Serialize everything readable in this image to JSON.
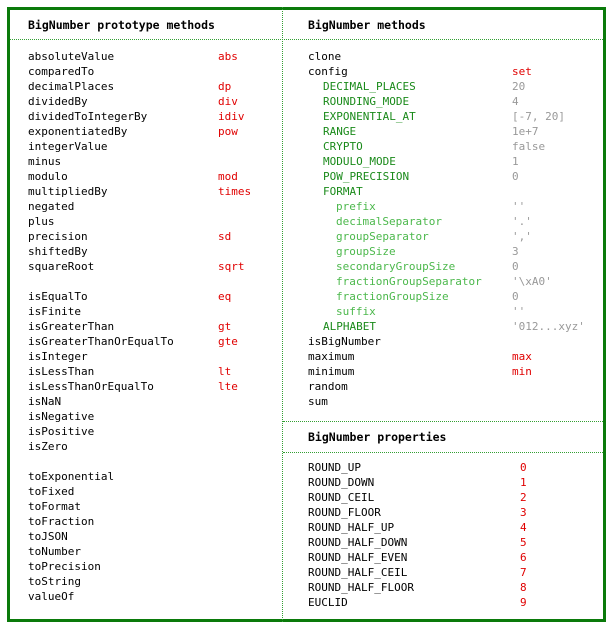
{
  "colors": {
    "border": "#0a7a0a",
    "divider": "#33a033",
    "alias": "#e00000",
    "config_option": "#1a8a1a",
    "format_option": "#4cb84c",
    "default_value": "#999999"
  },
  "prototype_methods": {
    "title": "BigNumber prototype methods",
    "groups": [
      [
        {
          "name": "absoluteValue",
          "alias": "abs"
        },
        {
          "name": "comparedTo",
          "alias": ""
        },
        {
          "name": "decimalPlaces",
          "alias": "dp"
        },
        {
          "name": "dividedBy",
          "alias": "div"
        },
        {
          "name": "dividedToIntegerBy",
          "alias": "idiv"
        },
        {
          "name": "exponentiatedBy",
          "alias": "pow"
        },
        {
          "name": "integerValue",
          "alias": ""
        },
        {
          "name": "minus",
          "alias": ""
        },
        {
          "name": "modulo",
          "alias": "mod"
        },
        {
          "name": "multipliedBy",
          "alias": "times"
        },
        {
          "name": "negated",
          "alias": ""
        },
        {
          "name": "plus",
          "alias": ""
        },
        {
          "name": "precision",
          "alias": "sd"
        },
        {
          "name": "shiftedBy",
          "alias": ""
        },
        {
          "name": "squareRoot",
          "alias": "sqrt"
        }
      ],
      [
        {
          "name": "isEqualTo",
          "alias": "eq"
        },
        {
          "name": "isFinite",
          "alias": ""
        },
        {
          "name": "isGreaterThan",
          "alias": "gt"
        },
        {
          "name": "isGreaterThanOrEqualTo",
          "alias": "gte"
        },
        {
          "name": "isInteger",
          "alias": ""
        },
        {
          "name": "isLessThan",
          "alias": "lt"
        },
        {
          "name": "isLessThanOrEqualTo",
          "alias": "lte"
        },
        {
          "name": "isNaN",
          "alias": ""
        },
        {
          "name": "isNegative",
          "alias": ""
        },
        {
          "name": "isPositive",
          "alias": ""
        },
        {
          "name": "isZero",
          "alias": ""
        }
      ],
      [
        {
          "name": "toExponential",
          "alias": ""
        },
        {
          "name": "toFixed",
          "alias": ""
        },
        {
          "name": "toFormat",
          "alias": ""
        },
        {
          "name": "toFraction",
          "alias": ""
        },
        {
          "name": "toJSON",
          "alias": ""
        },
        {
          "name": "toNumber",
          "alias": ""
        },
        {
          "name": "toPrecision",
          "alias": ""
        },
        {
          "name": "toString",
          "alias": ""
        },
        {
          "name": "valueOf",
          "alias": ""
        }
      ]
    ]
  },
  "methods": {
    "title": "BigNumber methods",
    "items": [
      {
        "name": "clone",
        "alias": "",
        "level": 0,
        "kind": "method"
      },
      {
        "name": "config",
        "alias": "set",
        "level": 0,
        "kind": "method"
      },
      {
        "name": "DECIMAL_PLACES",
        "value": "20",
        "level": 1,
        "kind": "cfg"
      },
      {
        "name": "ROUNDING_MODE",
        "value": "4",
        "level": 1,
        "kind": "cfg"
      },
      {
        "name": "EXPONENTIAL_AT",
        "value": "[-7, 20]",
        "level": 1,
        "kind": "cfg"
      },
      {
        "name": "RANGE",
        "value": "1e+7",
        "level": 1,
        "kind": "cfg"
      },
      {
        "name": "CRYPTO",
        "value": "false",
        "level": 1,
        "kind": "cfg"
      },
      {
        "name": "MODULO_MODE",
        "value": "1",
        "level": 1,
        "kind": "cfg"
      },
      {
        "name": "POW_PRECISION",
        "value": "0",
        "level": 1,
        "kind": "cfg"
      },
      {
        "name": "FORMAT",
        "value": "",
        "level": 1,
        "kind": "cfg"
      },
      {
        "name": "prefix",
        "value": "''",
        "level": 2,
        "kind": "fmt"
      },
      {
        "name": "decimalSeparator",
        "value": "'.'",
        "level": 2,
        "kind": "fmt"
      },
      {
        "name": "groupSeparator",
        "value": "','",
        "level": 2,
        "kind": "fmt"
      },
      {
        "name": "groupSize",
        "value": "3",
        "level": 2,
        "kind": "fmt"
      },
      {
        "name": "secondaryGroupSize",
        "value": "0",
        "level": 2,
        "kind": "fmt"
      },
      {
        "name": "fractionGroupSeparator",
        "value": "'\\xA0'",
        "level": 2,
        "kind": "fmt"
      },
      {
        "name": "fractionGroupSize",
        "value": "0",
        "level": 2,
        "kind": "fmt"
      },
      {
        "name": "suffix",
        "value": "''",
        "level": 2,
        "kind": "fmt"
      },
      {
        "name": "ALPHABET",
        "value": "'012...xyz'",
        "level": 1,
        "kind": "cfg"
      },
      {
        "name": "isBigNumber",
        "alias": "",
        "level": 0,
        "kind": "method"
      },
      {
        "name": "maximum",
        "alias": "max",
        "level": 0,
        "kind": "method"
      },
      {
        "name": "minimum",
        "alias": "min",
        "level": 0,
        "kind": "method"
      },
      {
        "name": "random",
        "alias": "",
        "level": 0,
        "kind": "method"
      },
      {
        "name": "sum",
        "alias": "",
        "level": 0,
        "kind": "method"
      }
    ]
  },
  "properties": {
    "title": "BigNumber properties",
    "items": [
      {
        "name": "ROUND_UP",
        "value": "0"
      },
      {
        "name": "ROUND_DOWN",
        "value": "1"
      },
      {
        "name": "ROUND_CEIL",
        "value": "2"
      },
      {
        "name": "ROUND_FLOOR",
        "value": "3"
      },
      {
        "name": "ROUND_HALF_UP",
        "value": "4"
      },
      {
        "name": "ROUND_HALF_DOWN",
        "value": "5"
      },
      {
        "name": "ROUND_HALF_EVEN",
        "value": "6"
      },
      {
        "name": "ROUND_HALF_CEIL",
        "value": "7"
      },
      {
        "name": "ROUND_HALF_FLOOR",
        "value": "8"
      },
      {
        "name": "EUCLID",
        "value": "9"
      }
    ]
  }
}
